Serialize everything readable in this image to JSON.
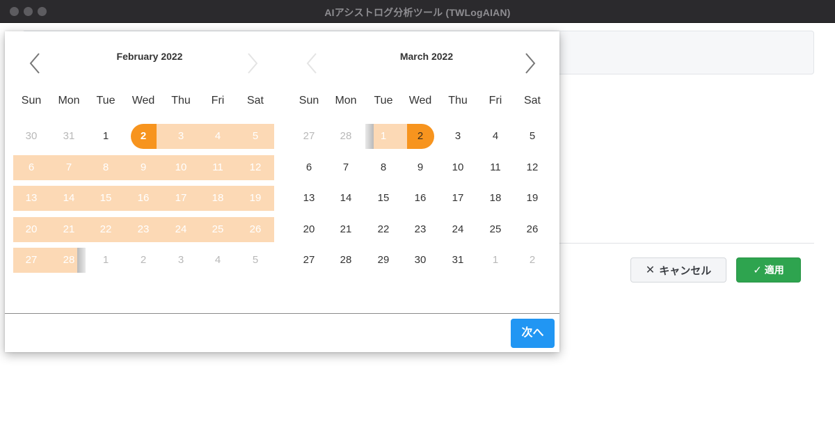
{
  "window": {
    "title": "AIアシストログ分析ツール (TWLogAIAN)"
  },
  "background": {
    "cancel_label": "キャンセル",
    "apply_label": "適用"
  },
  "picker": {
    "weekdays": [
      "Sun",
      "Mon",
      "Tue",
      "Wed",
      "Thu",
      "Fri",
      "Sat"
    ],
    "left": {
      "month": "February 2022",
      "weeks": [
        [
          "30",
          "31",
          "1",
          "2",
          "3",
          "4",
          "5"
        ],
        [
          "6",
          "7",
          "8",
          "9",
          "10",
          "11",
          "12"
        ],
        [
          "13",
          "14",
          "15",
          "16",
          "17",
          "18",
          "19"
        ],
        [
          "20",
          "21",
          "22",
          "23",
          "24",
          "25",
          "26"
        ],
        [
          "27",
          "28",
          "1",
          "2",
          "3",
          "4",
          "5"
        ]
      ]
    },
    "right": {
      "month": "March 2022",
      "weeks": [
        [
          "27",
          "28",
          "1",
          "2",
          "3",
          "4",
          "5"
        ],
        [
          "6",
          "7",
          "8",
          "9",
          "10",
          "11",
          "12"
        ],
        [
          "13",
          "14",
          "15",
          "16",
          "17",
          "18",
          "19"
        ],
        [
          "20",
          "21",
          "22",
          "23",
          "24",
          "25",
          "26"
        ],
        [
          "27",
          "28",
          "29",
          "30",
          "31",
          "1",
          "2"
        ]
      ]
    },
    "next_label": "次へ",
    "colors": {
      "range": "#fcd9b5",
      "endpoint": "#f7941e",
      "next_button": "#2196f3",
      "apply_button": "#2ea44f"
    }
  }
}
